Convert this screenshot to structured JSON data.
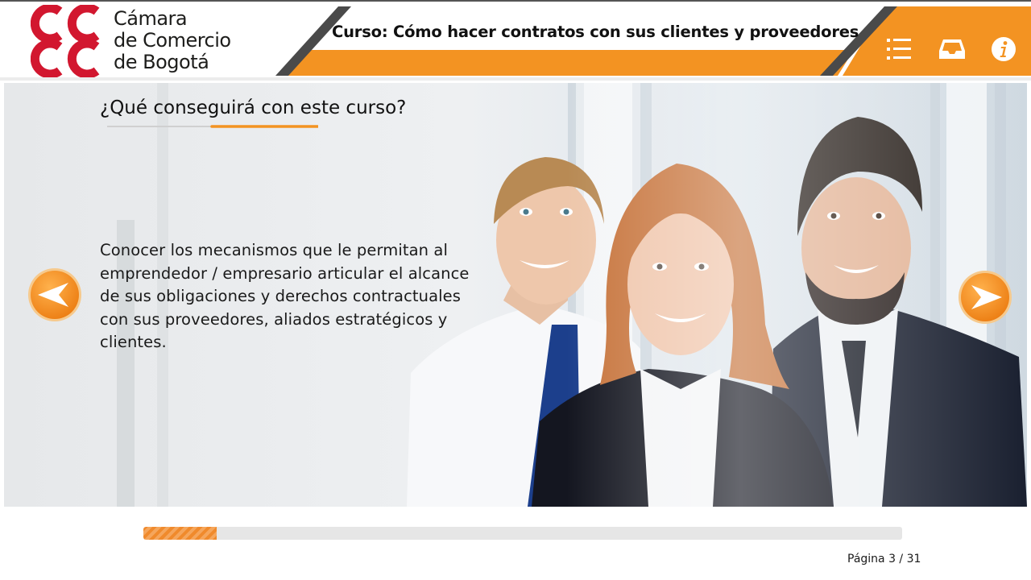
{
  "header": {
    "logo_lines": [
      "Cámara",
      "de Comercio",
      "de Bogotá"
    ],
    "course_title": "Curso: Cómo hacer contratos con sus clientes y proveedores",
    "icons": [
      "list-menu-icon",
      "inbox-tray-icon",
      "info-icon"
    ]
  },
  "slide": {
    "heading": "¿Qué conseguirá con este curso?",
    "body": "Conocer los mecanismos que le permitan al emprendedor / empresario articular el alcance de sus obligaciones y derechos contractuales con sus proveedores, aliados estratégicos y clientes.",
    "prev_icon": "arrow-left-icon",
    "next_icon": "arrow-right-icon"
  },
  "footer": {
    "progress_fraction": 0.0968,
    "page_indicator": "Página 3 / 31"
  },
  "colors": {
    "brand_red": "#d2172f",
    "accent_orange": "#f39322",
    "dark_gray": "#4a4a4a"
  }
}
